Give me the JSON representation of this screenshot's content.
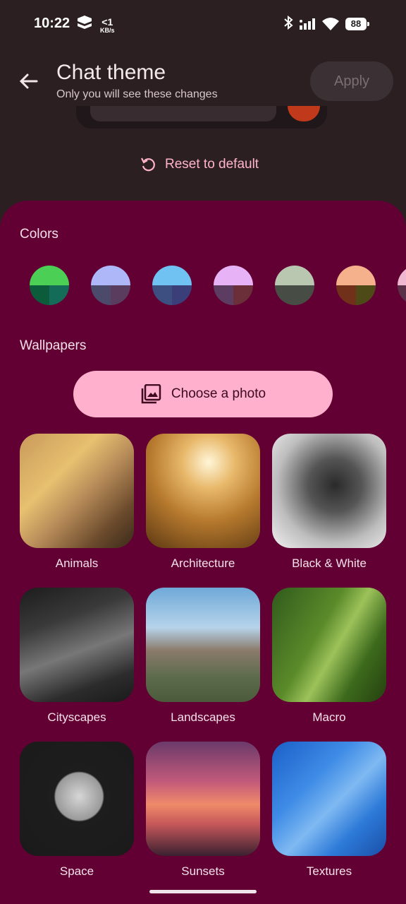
{
  "status": {
    "time": "10:22",
    "net_speed_value": "<1",
    "net_speed_unit": "KB/s",
    "battery": "88"
  },
  "header": {
    "title": "Chat theme",
    "subtitle": "Only you will see these changes",
    "apply_label": "Apply"
  },
  "reset_label": "Reset to default",
  "colors_section": {
    "label": "Colors",
    "swatches": [
      {
        "top": "#4ccf55",
        "bottom_left": "#0c5c3b",
        "bottom_right": "#136b58"
      },
      {
        "top": "#aeb7f7",
        "bottom_left": "#4c4a6b",
        "bottom_right": "#5a3d5e"
      },
      {
        "top": "#6fc2f2",
        "bottom_left": "#3d4f80",
        "bottom_right": "#3a3f7a"
      },
      {
        "top": "#e7b3f6",
        "bottom_left": "#5c3c61",
        "bottom_right": "#6a2f38"
      },
      {
        "top": "#b9c7b1",
        "bottom_left": "#474d44",
        "bottom_right": "#474d44"
      },
      {
        "top": "#f5b08c",
        "bottom_left": "#703019",
        "bottom_right": "#4d4a18"
      },
      {
        "top": "#f0b8d0",
        "bottom_left": "#5a3048",
        "bottom_right": "#5a3048"
      }
    ]
  },
  "wallpapers_section": {
    "label": "Wallpapers",
    "choose_label": "Choose a photo",
    "items": [
      {
        "label": "Animals",
        "bg": "linear-gradient(135deg,#c89a5a 0%,#e8c070 35%,#b98d5a 55%,#6b4a2c 80%,#3a2a1a 100%)"
      },
      {
        "label": "Architecture",
        "bg": "radial-gradient(circle at 55% 25%,#fff6d8 0%,#e8b86a 25%,#b77a2e 55%,#5c3812 100%)"
      },
      {
        "label": "Black & White",
        "bg": "radial-gradient(circle at 55% 45%,#2a2a2a 0%,#555 30%,#bdbdbd 65%,#f2f2f2 100%)"
      },
      {
        "label": "Cityscapes",
        "bg": "linear-gradient(160deg,#1c1c1c 0%,#3a3a3a 30%,#777 55%,#2c2c2c 80%,#1a1a1a 100%)"
      },
      {
        "label": "Landscapes",
        "bg": "linear-gradient(180deg,#6fa9d8 0%,#b6d3ea 35%,#8a7a6a 55%,#5a6a4a 80%,#4a5a3a 100%)"
      },
      {
        "label": "Macro",
        "bg": "linear-gradient(120deg,#2f5a1c 0%,#5b8a2a 40%,#9cc25a 55%,#3d6a1c 75%,#24400f 100%)"
      },
      {
        "label": "Space",
        "bg": "radial-gradient(circle at 52% 48%,#d6d6d6 0%,#9a9a9a 28%,#1d1d1d 30%,#1a1a1a 100%)"
      },
      {
        "label": "Sunsets",
        "bg": "linear-gradient(180deg,#6b3a6a 0%,#c25a7a 35%,#f08a6a 55%,#c6585a 72%,#3a2030 100%)"
      },
      {
        "label": "Textures",
        "bg": "linear-gradient(135deg,#1a5fc8 0%,#3f8ce6 35%,#7fb9f2 55%,#2d7ad8 75%,#1a4fa8 100%)"
      }
    ]
  }
}
